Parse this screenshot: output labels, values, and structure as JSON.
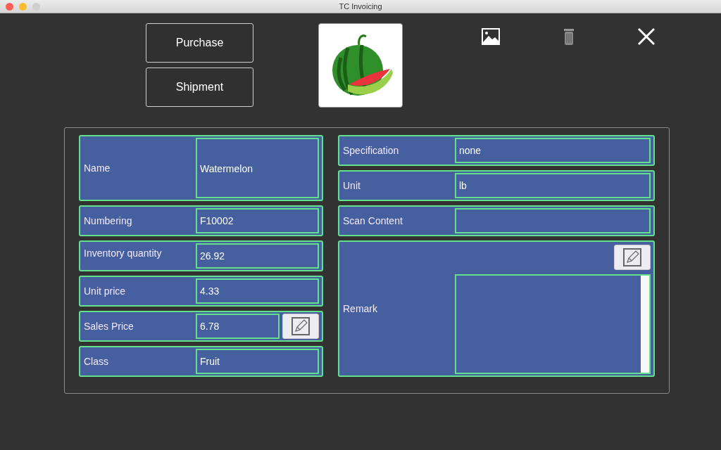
{
  "window": {
    "title": "TC Invoicing"
  },
  "actions": [
    {
      "label": "Purchase"
    },
    {
      "label": "Shipment"
    }
  ],
  "left_fields": [
    {
      "kind": "tall",
      "label": "Name",
      "value": "Watermelon"
    },
    {
      "kind": "field",
      "label": "Numbering",
      "value": "F10002"
    },
    {
      "kind": "top-label",
      "label": "Inventory quantity",
      "value": "26.92"
    },
    {
      "kind": "field",
      "label": "Unit price",
      "value": "4.33"
    },
    {
      "kind": "edit",
      "label": "Sales Price",
      "value": "6.78"
    },
    {
      "kind": "field",
      "label": "Class",
      "value": "Fruit"
    }
  ],
  "right_fields": [
    {
      "kind": "field",
      "label": "Specification",
      "value": "none"
    },
    {
      "kind": "field",
      "label": "Unit",
      "value": "lb"
    },
    {
      "kind": "field",
      "label": "Scan Content"
    },
    {
      "kind": "textarea",
      "label": "Remark"
    }
  ]
}
